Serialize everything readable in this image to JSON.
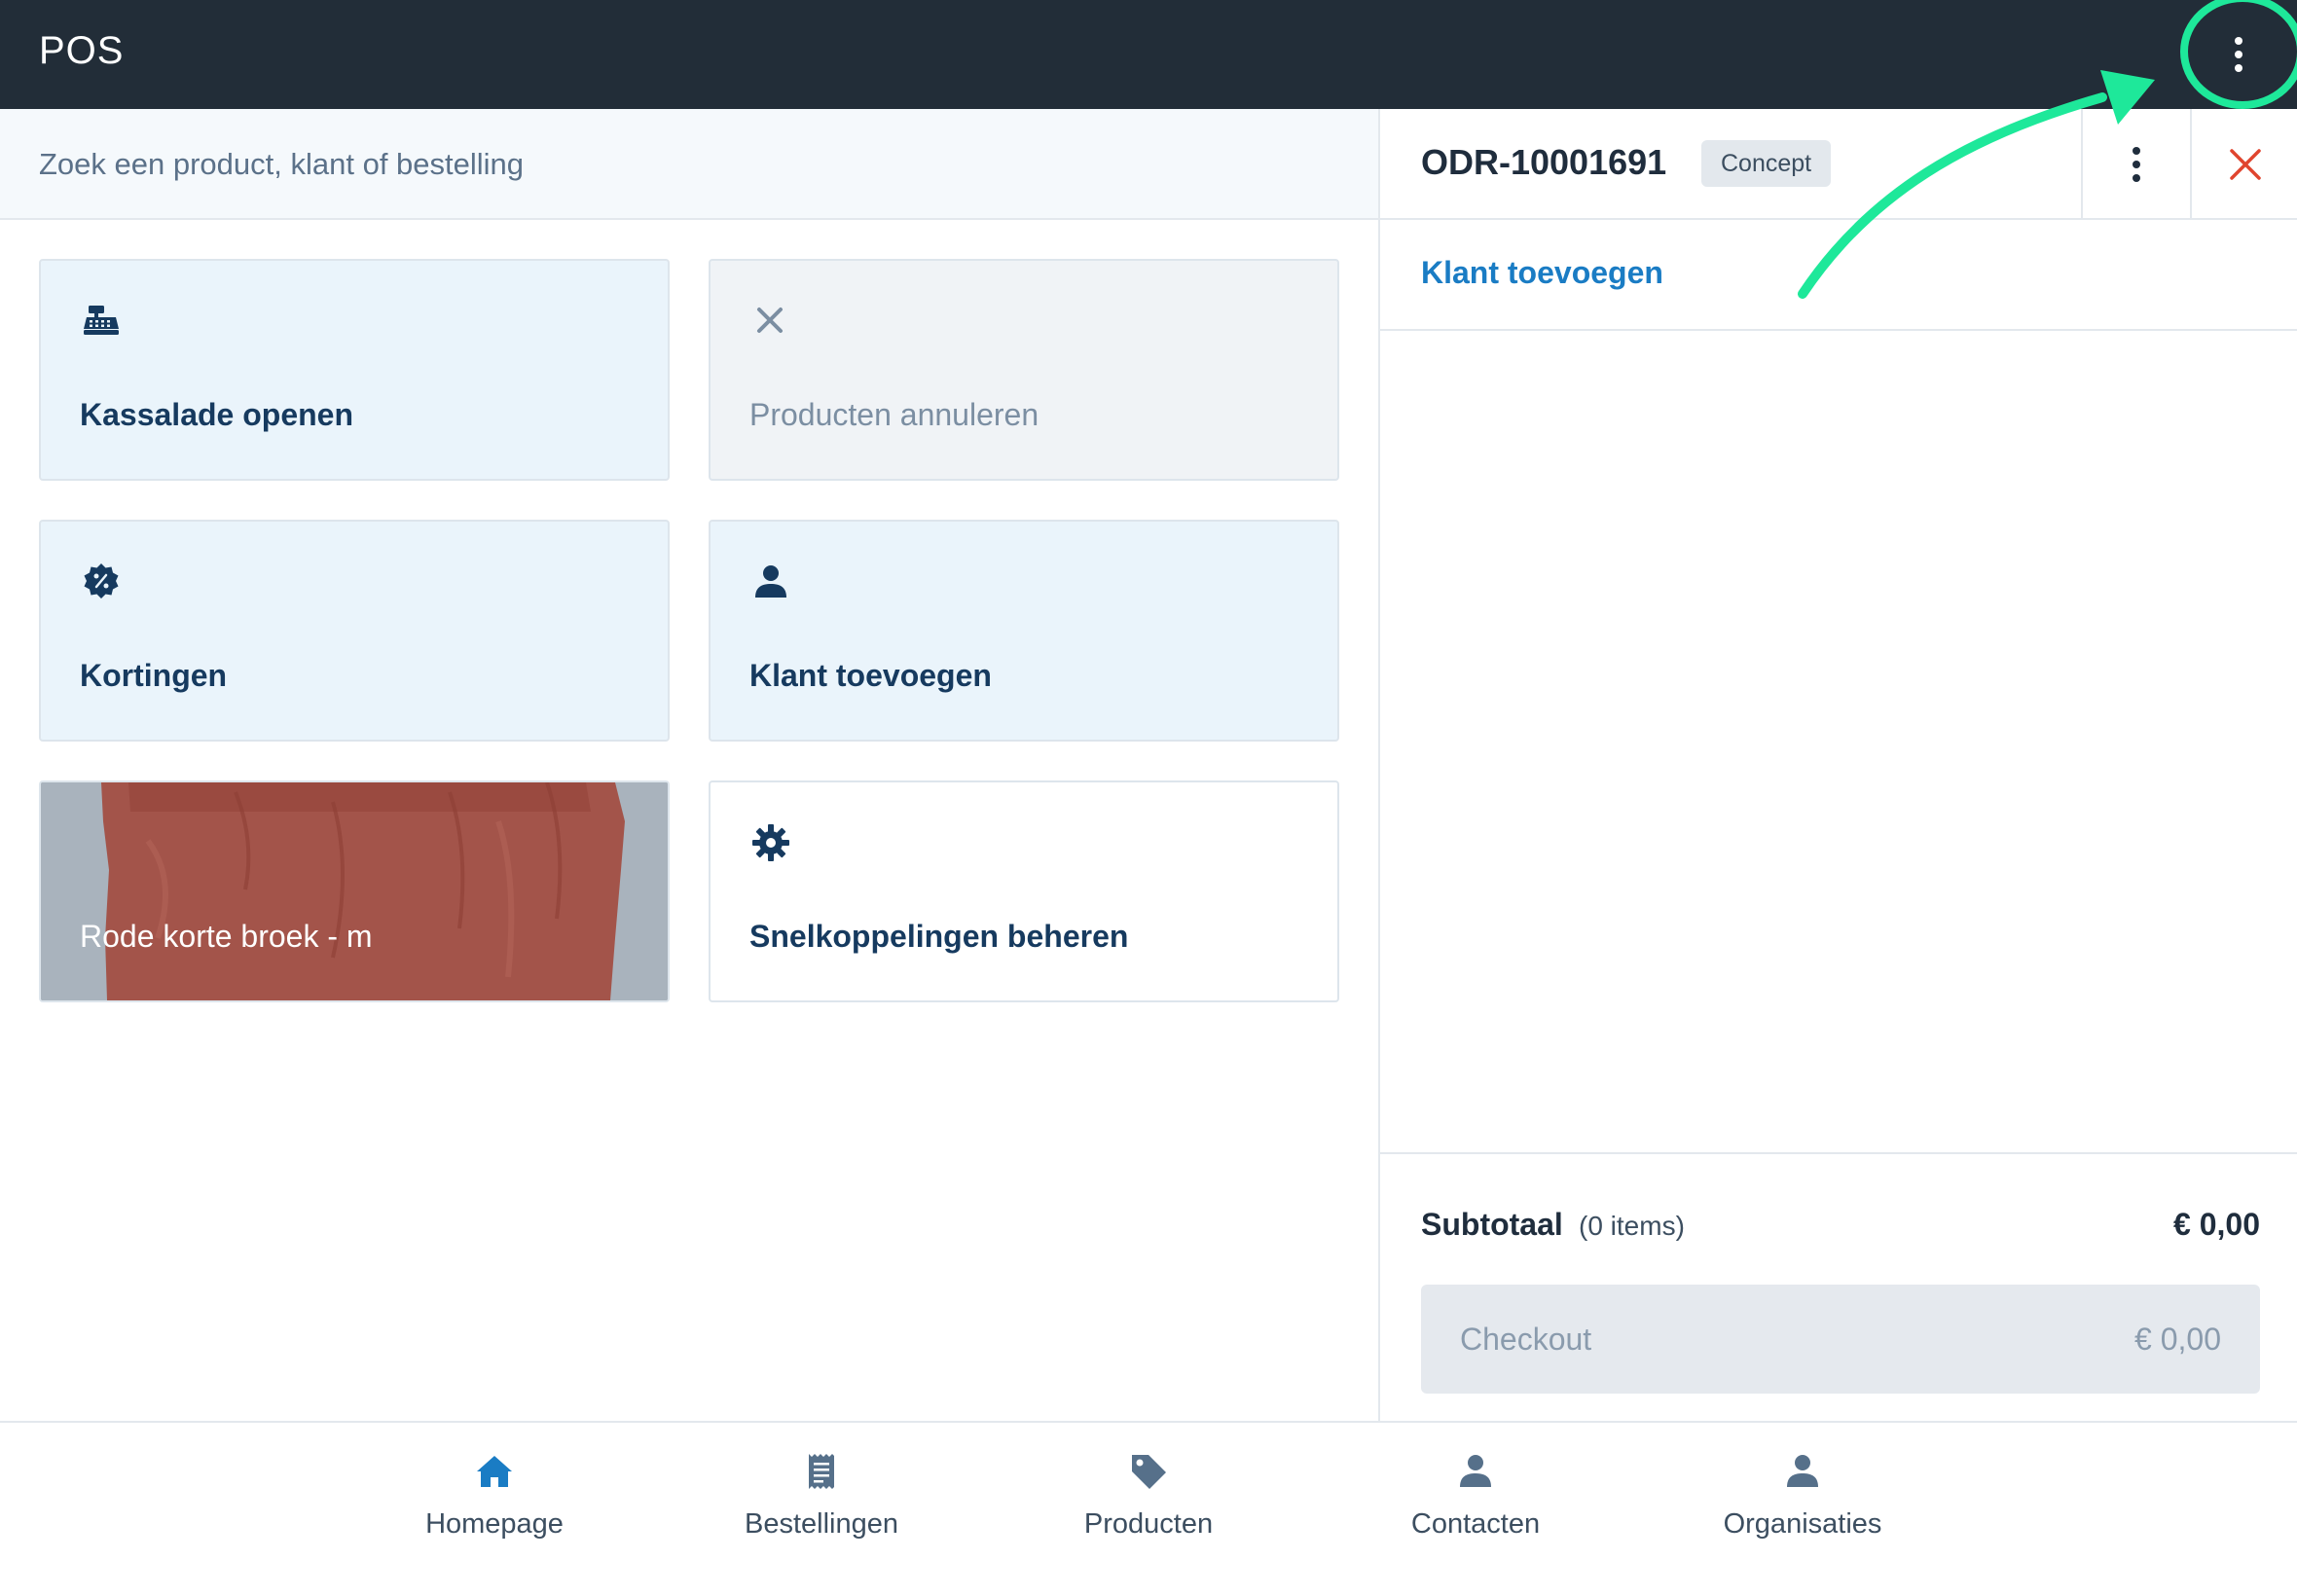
{
  "app": {
    "title": "POS"
  },
  "search": {
    "placeholder": "Zoek een product, klant of bestelling"
  },
  "tiles": [
    {
      "label": "Kassalade openen",
      "icon": "cash-register-icon",
      "state": "enabled"
    },
    {
      "label": "Producten annuleren",
      "icon": "close-icon",
      "state": "disabled"
    },
    {
      "label": "Kortingen",
      "icon": "discount-badge-icon",
      "state": "enabled"
    },
    {
      "label": "Klant toevoegen",
      "icon": "user-icon",
      "state": "enabled"
    },
    {
      "label": "Rode korte broek - m",
      "icon": "product-photo",
      "state": "enabled"
    },
    {
      "label": "Snelkoppelingen beheren",
      "icon": "gear-icon",
      "state": "enabled"
    }
  ],
  "order": {
    "id": "ODR-10001691",
    "status": "Concept",
    "add_customer_label": "Klant toevoegen",
    "subtotal_label": "Subtotaal",
    "subtotal_count": "(0 items)",
    "subtotal_value": "€ 0,00",
    "checkout_label": "Checkout",
    "checkout_value": "€ 0,00"
  },
  "bottom_nav": [
    {
      "label": "Homepage",
      "icon": "home-icon",
      "active": true
    },
    {
      "label": "Bestellingen",
      "icon": "receipt-icon",
      "active": false
    },
    {
      "label": "Producten",
      "icon": "tag-icon",
      "active": false
    },
    {
      "label": "Contacten",
      "icon": "user-icon",
      "active": false
    },
    {
      "label": "Organisaties",
      "icon": "user-icon",
      "active": false
    }
  ],
  "colors": {
    "topbar": "#222d38",
    "accent": "#1a7cc4",
    "tile_bg": "#eaf4fb",
    "highlight": "#1ee89a",
    "close_red": "#e0452f"
  }
}
